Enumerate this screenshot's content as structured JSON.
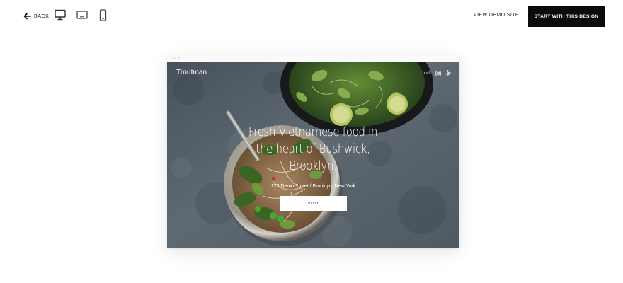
{
  "toolbar": {
    "back_label": "BACK",
    "view_demo_label": "VIEW DEMO SITE",
    "cta_label": "START WITH THIS DESIGN",
    "devices": [
      "desktop-icon",
      "tablet-icon",
      "mobile-icon"
    ]
  },
  "preview": {
    "site_name": "Troutman",
    "nav": {
      "call_label": "call",
      "icons": [
        "instagram-icon",
        "yelp-icon"
      ]
    },
    "headline": "Fresh Vietnamese food in the heart of Bushwick, Brooklyn.",
    "address": "123 Demo Street / Brooklyn, New York",
    "visit_label": "Visit"
  },
  "colors": {
    "cta_background": "#0b0b0b",
    "hero_background": "#5d6872",
    "text_on_hero": "#ffffff"
  }
}
